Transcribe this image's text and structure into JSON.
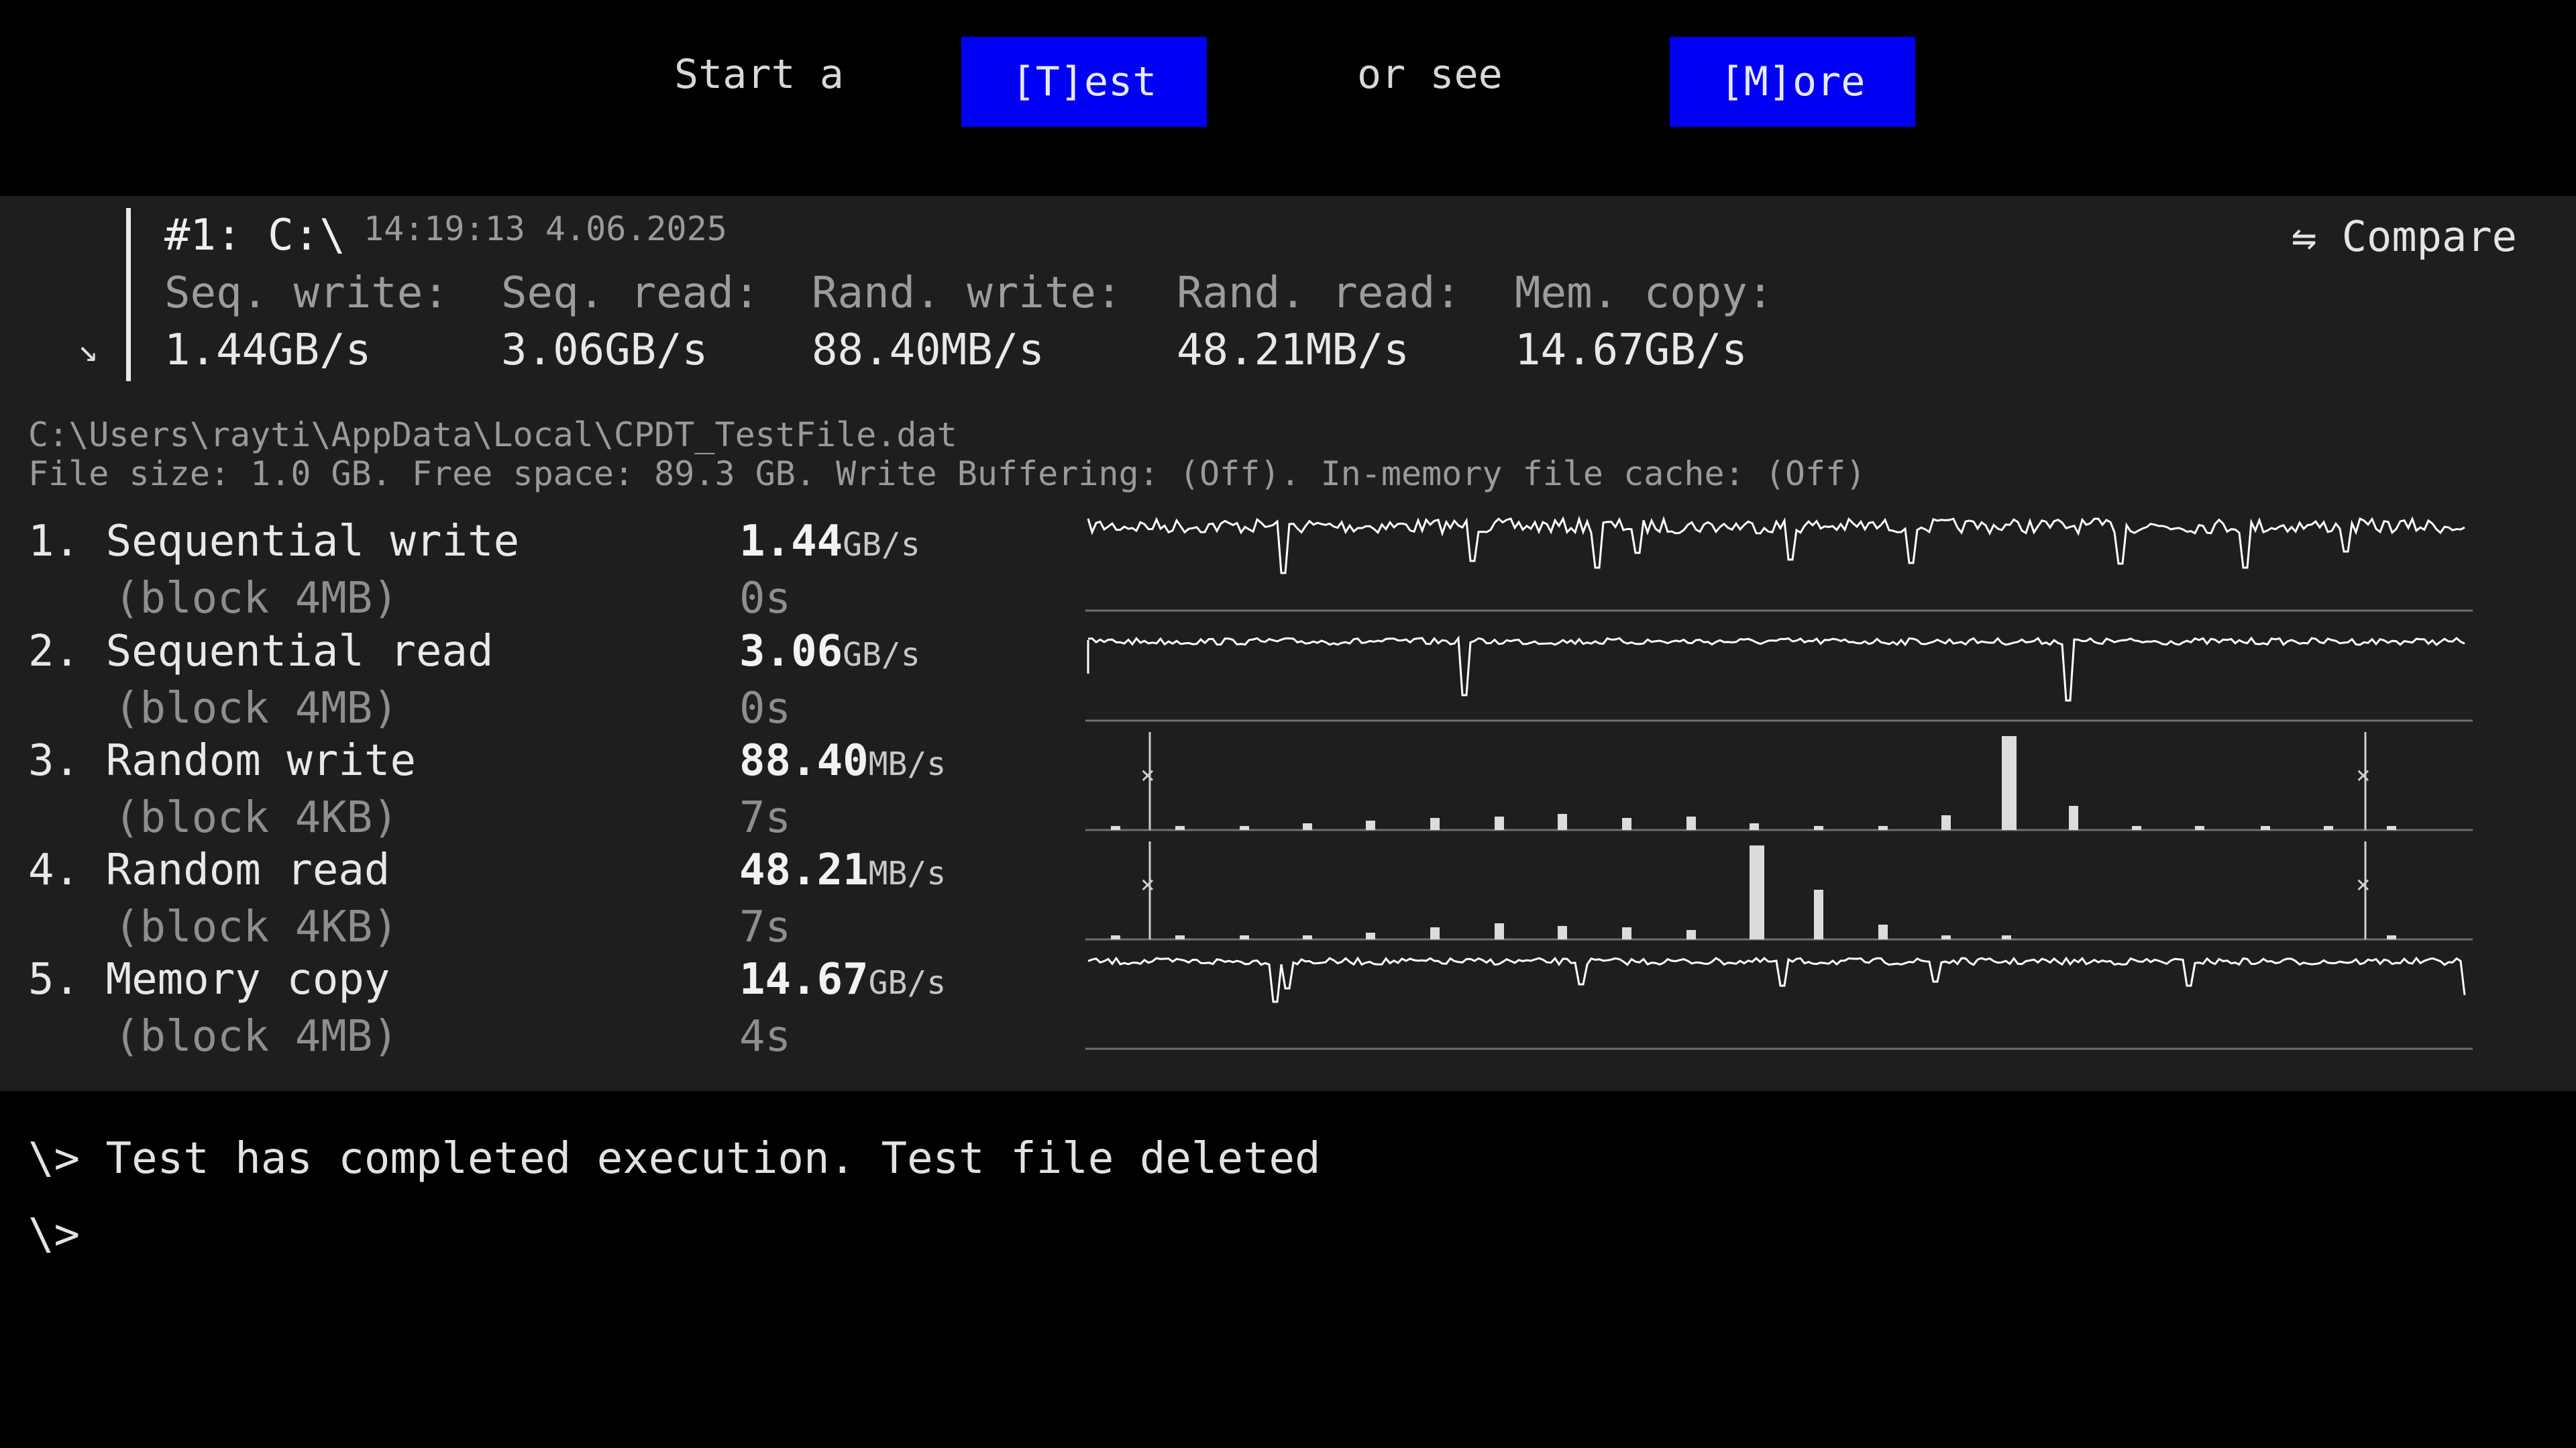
{
  "topbar": {
    "start_text": "Start a",
    "test_button": "[T]est",
    "or_text": "or see",
    "more_button": "[M]ore"
  },
  "run": {
    "title": "#1: C:\\",
    "timestamp": "14:19:13 4.06.2025",
    "collapse_icon": "↘",
    "compare_label": "⇋ Compare",
    "summary": [
      {
        "label": "Seq. write:",
        "value": "1.44GB/s"
      },
      {
        "label": "Seq. read:",
        "value": "3.06GB/s"
      },
      {
        "label": "Rand. write:",
        "value": "88.40MB/s"
      },
      {
        "label": "Rand. read:",
        "value": "48.21MB/s"
      },
      {
        "label": "Mem. copy:",
        "value": "14.67GB/s"
      }
    ]
  },
  "file_info": {
    "path": "C:\\Users\\rayti\\AppData\\Local\\CPDT_TestFile.dat",
    "details": "File size: 1.0 GB. Free space: 89.3 GB. Write Buffering: (Off). In-memory file cache: (Off)"
  },
  "tests": [
    {
      "name": "1. Sequential write",
      "block": "(block 4MB)",
      "value": "1.44",
      "unit": "GB/s",
      "time": "0s",
      "graph": "seqwrite"
    },
    {
      "name": "2. Sequential read",
      "block": "(block 4MB)",
      "value": "3.06",
      "unit": "GB/s",
      "time": "0s",
      "graph": "seqread"
    },
    {
      "name": "3. Random write",
      "block": "(block 4KB)",
      "value": "88.40",
      "unit": "MB/s",
      "time": "7s",
      "graph": "randwrite"
    },
    {
      "name": "4. Random read",
      "block": "(block 4KB)",
      "value": "48.21",
      "unit": "MB/s",
      "time": "7s",
      "graph": "randread"
    },
    {
      "name": "5. Memory copy",
      "block": "(block 4MB)",
      "value": "14.67",
      "unit": "GB/s",
      "time": "4s",
      "graph": "memcopy"
    }
  ],
  "console": {
    "line1": "\\> Test has completed execution. Test file deleted",
    "line2": "\\>"
  },
  "colors": {
    "button_bg": "#0000f5",
    "panel_bg": "#1e1e1e",
    "page_bg": "#000000",
    "graph_line": "#ffffff"
  }
}
